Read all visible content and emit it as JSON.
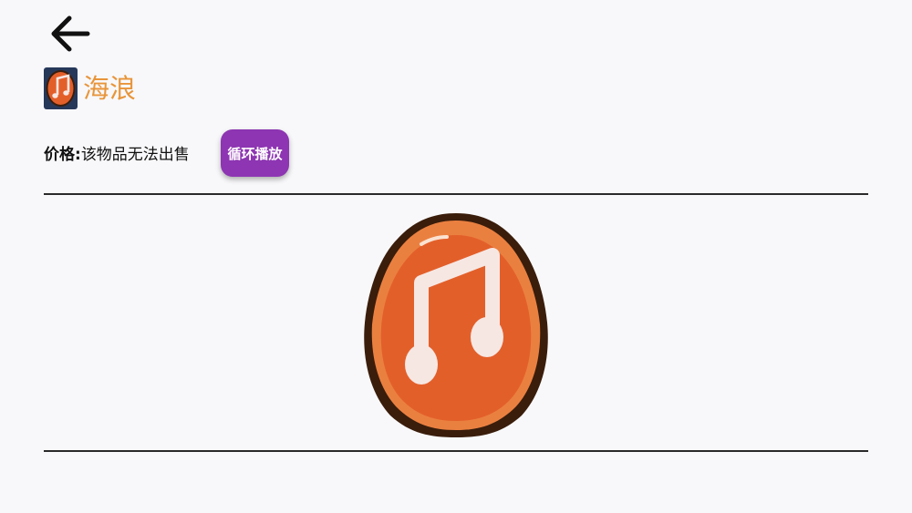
{
  "header": {
    "back_icon": "arrow-left-icon"
  },
  "item": {
    "title": "海浪",
    "icon": "music-note-badge-icon",
    "title_color": "#e8953a"
  },
  "price": {
    "label": "价格:",
    "value": "该物品无法出售"
  },
  "actions": {
    "loop_play_label": "循环播放",
    "loop_play_color": "#8d35b2"
  },
  "preview": {
    "icon": "music-note-badge-icon"
  }
}
